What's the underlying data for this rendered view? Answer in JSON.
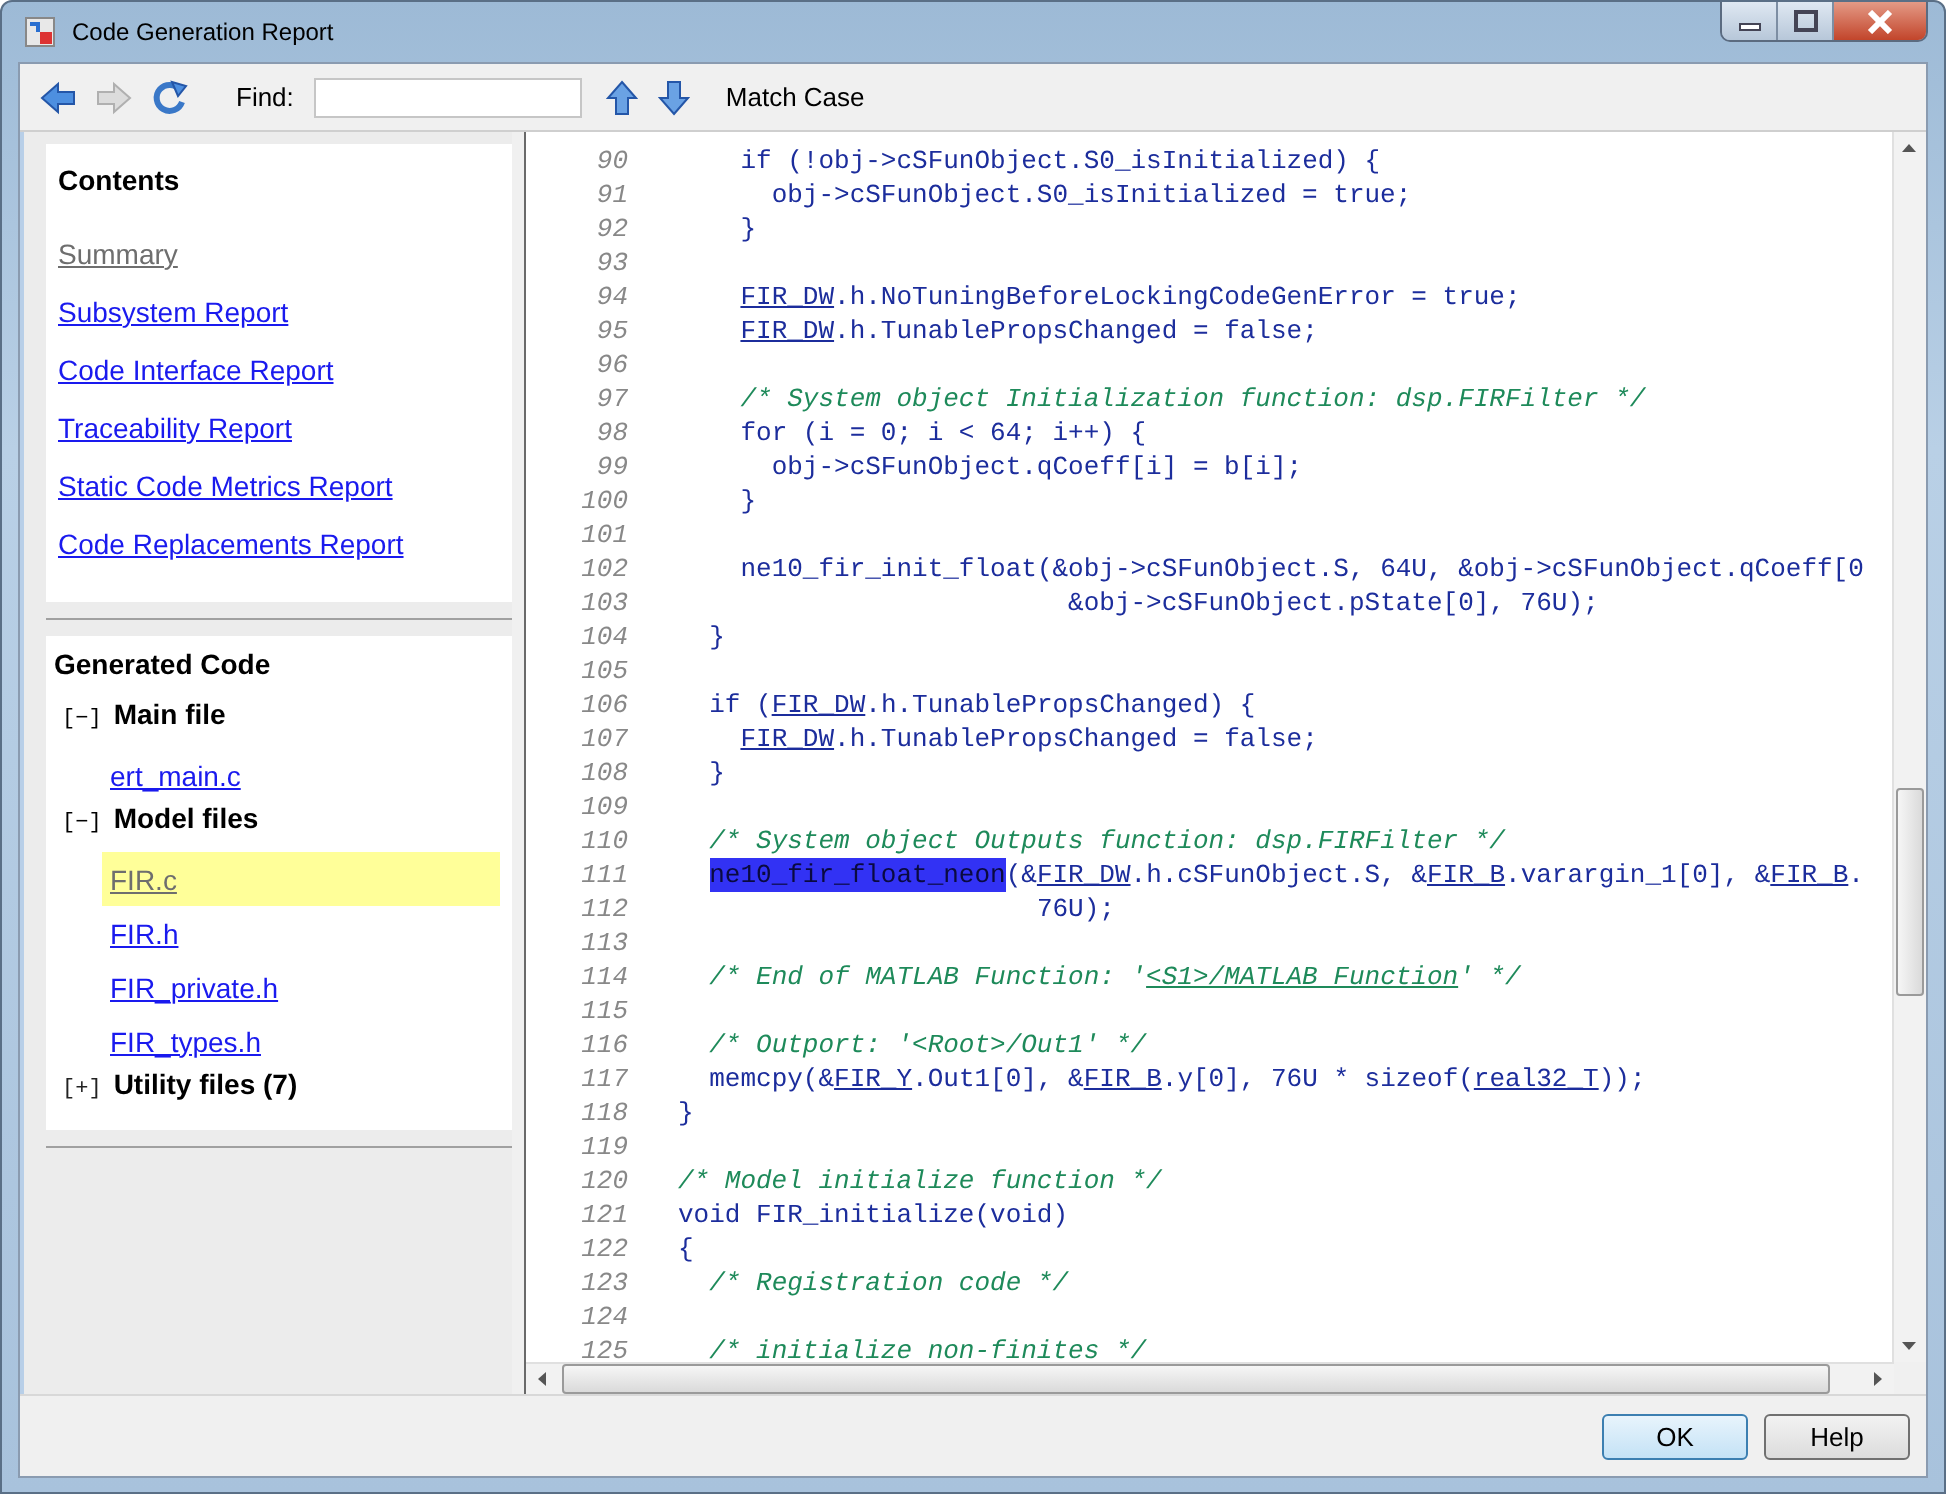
{
  "window": {
    "title": "Code Generation Report"
  },
  "toolbar": {
    "nav_buttons": [
      {
        "kind": "back",
        "disabled": false
      },
      {
        "kind": "forward",
        "disabled": true
      },
      {
        "kind": "refresh",
        "disabled": false
      }
    ],
    "find_label": "Find:",
    "find_nav": [
      {
        "kind": "up"
      },
      {
        "kind": "down"
      }
    ],
    "match_case": "Match Case"
  },
  "contents": {
    "title": "Contents",
    "items": [
      {
        "label": "Summary",
        "selected": true
      },
      {
        "label": "Subsystem Report",
        "selected": false
      },
      {
        "label": "Code Interface Report",
        "selected": false
      },
      {
        "label": "Traceability Report",
        "selected": false
      },
      {
        "label": "Static Code Metrics Report",
        "selected": false
      },
      {
        "label": "Code Replacements Report",
        "selected": false
      }
    ]
  },
  "generated_code": {
    "title": "Generated Code",
    "sections": [
      {
        "toggle": "[−]",
        "label": "Main file",
        "expanded": true,
        "files": [
          {
            "label": "ert_main.c",
            "selected": false
          }
        ]
      },
      {
        "toggle": "[−]",
        "label": "Model files",
        "expanded": true,
        "files": [
          {
            "label": "FIR.c",
            "selected": true
          },
          {
            "label": "FIR.h",
            "selected": false
          },
          {
            "label": "FIR_private.h",
            "selected": false
          },
          {
            "label": "FIR_types.h",
            "selected": false
          }
        ]
      },
      {
        "toggle": "[+]",
        "label": "Utility files (7)",
        "expanded": false
      }
    ]
  },
  "code": {
    "lines": [
      {
        "number": "90",
        "segments": [
          {
            "kind": "code",
            "text": "    if (!obj->cSFunObject.S0_isInitialized) {"
          }
        ]
      },
      {
        "number": "91",
        "segments": [
          {
            "kind": "code",
            "text": "      obj->cSFunObject.S0_isInitialized = true;"
          }
        ]
      },
      {
        "number": "92",
        "segments": [
          {
            "kind": "code",
            "text": "    }"
          }
        ]
      },
      {
        "number": "93"
      },
      {
        "number": "94",
        "segments": [
          {
            "kind": "link",
            "text": "    FIR_DW"
          },
          {
            "kind": "code",
            "text": ".h.NoTuningBeforeLockingCodeGenError = true;"
          }
        ]
      },
      {
        "number": "95",
        "segments": [
          {
            "kind": "link",
            "text": "    FIR_DW"
          },
          {
            "kind": "code",
            "text": ".h.TunablePropsChanged = false;"
          }
        ]
      },
      {
        "number": "96"
      },
      {
        "number": "97",
        "segments": [
          {
            "kind": "comment",
            "text": "    /* System object Initialization function: dsp.FIRFilter */"
          }
        ]
      },
      {
        "number": "98",
        "segments": [
          {
            "kind": "code",
            "text": "    for (i = 0; i < 64; i++) {"
          }
        ]
      },
      {
        "number": "99",
        "segments": [
          {
            "kind": "code",
            "text": "      obj->cSFunObject.qCoeff[i] = b[i];"
          }
        ]
      },
      {
        "number": "100",
        "segments": [
          {
            "kind": "code",
            "text": "    }"
          }
        ]
      },
      {
        "number": "101"
      },
      {
        "number": "102",
        "segments": [
          {
            "kind": "code",
            "text": "    ne10_fir_init_float(&obj->cSFunObject.S, 64U, &obj->cSFunObject.qCoeff[0"
          }
        ]
      },
      {
        "number": "103",
        "segments": [
          {
            "kind": "code",
            "text": "                         &obj->cSFunObject.pState[0], 76U);"
          }
        ]
      },
      {
        "number": "104",
        "segments": [
          {
            "kind": "code",
            "text": "  }"
          }
        ]
      },
      {
        "number": "105"
      },
      {
        "number": "106",
        "segments": [
          {
            "kind": "code",
            "text": "  if ("
          },
          {
            "kind": "link",
            "text": "FIR_DW"
          },
          {
            "kind": "code",
            "text": ".h.TunablePropsChanged) {"
          }
        ]
      },
      {
        "number": "107",
        "segments": [
          {
            "kind": "link",
            "text": "    FIR_DW"
          },
          {
            "kind": "code",
            "text": ".h.TunablePropsChanged = false;"
          }
        ]
      },
      {
        "number": "108",
        "segments": [
          {
            "kind": "code",
            "text": "  }"
          }
        ]
      },
      {
        "number": "109"
      },
      {
        "number": "110",
        "segments": [
          {
            "kind": "comment",
            "text": "  /* System object Outputs function: dsp.FIRFilter */"
          }
        ]
      },
      {
        "number": "111",
        "segments": [
          {
            "kind": "highlight",
            "text": "  ne10_fir_float_neon"
          },
          {
            "kind": "code",
            "text": "(&"
          },
          {
            "kind": "link",
            "text": "FIR_DW"
          },
          {
            "kind": "code",
            "text": ".h.cSFunObject.S, &"
          },
          {
            "kind": "link",
            "text": "FIR_B"
          },
          {
            "kind": "code",
            "text": ".varargin_1[0], &"
          },
          {
            "kind": "link",
            "text": "FIR_B"
          },
          {
            "kind": "code",
            "text": "."
          }
        ]
      },
      {
        "number": "112",
        "segments": [
          {
            "kind": "code",
            "text": "                       76U);"
          }
        ]
      },
      {
        "number": "113"
      },
      {
        "number": "114",
        "segments": [
          {
            "kind": "comment",
            "text": "  /* End of MATLAB Function: '"
          },
          {
            "kind": "comment-link",
            "text": "<S1>/MATLAB Function"
          },
          {
            "kind": "comment",
            "text": "' */"
          }
        ]
      },
      {
        "number": "115"
      },
      {
        "number": "116",
        "segments": [
          {
            "kind": "comment",
            "text": "  /* Outport: '<Root>/Out1' */"
          }
        ]
      },
      {
        "number": "117",
        "segments": [
          {
            "kind": "code",
            "text": "  memcpy(&"
          },
          {
            "kind": "link",
            "text": "FIR_Y"
          },
          {
            "kind": "code",
            "text": ".Out1[0], &"
          },
          {
            "kind": "link",
            "text": "FIR_B"
          },
          {
            "kind": "code",
            "text": ".y[0], 76U * sizeof("
          },
          {
            "kind": "link",
            "text": "real32_T"
          },
          {
            "kind": "code",
            "text": "));"
          }
        ]
      },
      {
        "number": "118",
        "segments": [
          {
            "kind": "code",
            "text": "}"
          }
        ]
      },
      {
        "number": "119"
      },
      {
        "number": "120",
        "segments": [
          {
            "kind": "comment",
            "text": "/* Model initialize function */"
          }
        ]
      },
      {
        "number": "121",
        "segments": [
          {
            "kind": "code",
            "text": "void FIR_initialize(void)"
          }
        ]
      },
      {
        "number": "122",
        "segments": [
          {
            "kind": "code",
            "text": "{"
          }
        ]
      },
      {
        "number": "123",
        "segments": [
          {
            "kind": "comment",
            "text": "  /* Registration code */"
          }
        ]
      },
      {
        "number": "124"
      },
      {
        "number": "125",
        "segments": [
          {
            "kind": "comment",
            "text": "  /* initialize non-finites */"
          }
        ]
      }
    ]
  },
  "buttons": [
    {
      "label": "OK",
      "default": true
    },
    {
      "label": "Help",
      "default": false
    }
  ]
}
